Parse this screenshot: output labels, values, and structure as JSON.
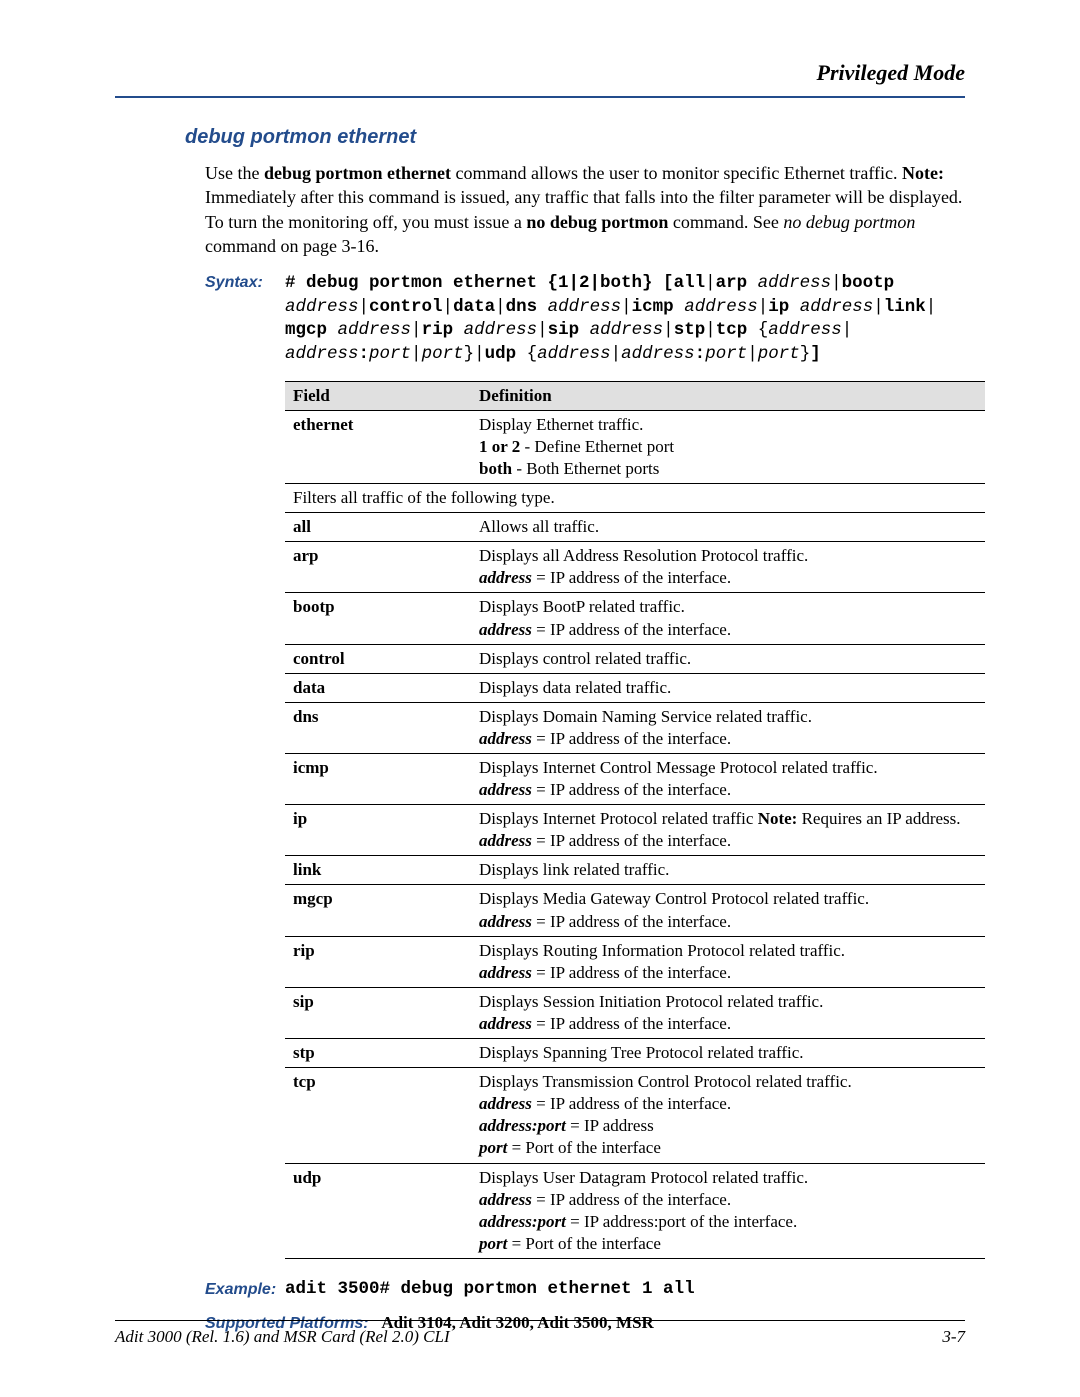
{
  "header": {
    "title": "Privileged Mode"
  },
  "section": {
    "title": "debug portmon ethernet"
  },
  "intro": {
    "html": "Use the <b>debug portmon ethernet</b> command allows the user to monitor specific Ethernet traffic. <b>Note:</b> Immediately after this command is issued, any traffic that falls into the filter parameter will be displayed. To turn the monitoring off, you must issue a <b>no debug portmon</b> command. See <i>no debug portmon</i> command on page 3-16."
  },
  "syntax": {
    "label": "Syntax:",
    "code": "<b># debug portmon ethernet {1|2|both} [all</b>|<b>arp</b> <i>address</i>|<b>bootp</b> <i>address</i>|<b>control</b>|<b>data</b>|<b>dns</b> <i>address</i>|<b>icmp</b> <i>address</i>|<b>ip</b> <i>address</i>|<b>link</b>| <b>mgcp</b> <i>address</i>|<b>rip</b> <i>address</i>|<b>sip</b> <i>address</i>|<b>stp</b>|<b>tcp</b> {<i>address</i>| <i>address</i><b>:</b><i>port</i>|<i>port</i>}|<b>udp</b> {<i>address</i>|<i>address</i><b>:</b><i>port</i>|<i>port</i>}<b>]</b>"
  },
  "table": {
    "headers": {
      "field": "Field",
      "definition": "Definition"
    },
    "rows": [
      {
        "field": "ethernet",
        "def": "Display Ethernet traffic.<br><b>1 or 2</b> - Define Ethernet port<br><b>both</b> - Both Ethernet ports"
      },
      {
        "merged": true,
        "def": "Filters all traffic of the following type."
      },
      {
        "field": "all",
        "def": "Allows all traffic."
      },
      {
        "field": "arp",
        "def": "Displays all Address Resolution Protocol traffic.<br><i>address</i> = IP address of the interface."
      },
      {
        "field": "bootp",
        "def": "Displays BootP related traffic.<br><i>address</i> = IP address of the interface."
      },
      {
        "field": "control",
        "def": "Displays control related traffic."
      },
      {
        "field": "data",
        "def": "Displays data related traffic."
      },
      {
        "field": "dns",
        "def": "Displays Domain Naming Service related traffic.<br><i>address</i> = IP address of the interface."
      },
      {
        "field": "icmp",
        "def": "Displays Internet Control Message Protocol related traffic.<br><i>address</i> = IP address of the interface."
      },
      {
        "field": "ip",
        "def": "Displays Internet Protocol related traffic <b class=\"note-bold\">Note:</b> Requires an IP address.<br><i>address</i> = IP address of the interface."
      },
      {
        "field": "link",
        "def": "Displays link related traffic."
      },
      {
        "field": "mgcp",
        "def": "Displays Media Gateway Control Protocol related traffic.<br><i>address</i> = IP address of the interface."
      },
      {
        "field": "rip",
        "def": "Displays Routing Information Protocol related traffic.<br><i>address</i> = IP address of the interface."
      },
      {
        "field": "sip",
        "def": "Displays Session Initiation Protocol related traffic.<br><i>address</i> = IP address of the interface."
      },
      {
        "field": "stp",
        "def": "Displays Spanning Tree Protocol related traffic."
      },
      {
        "field": "tcp",
        "def": "Displays Transmission Control Protocol related traffic.<br><i>address</i> = IP address of the interface.<br><i>address:port</i> = IP address<br><i>port</i> = Port of the interface"
      },
      {
        "field": "udp",
        "def": "Displays User Datagram Protocol related traffic.<br><i>address</i> = IP address of the interface.<br><i>address:port</i> = IP address:port of the interface.<br><i>port</i> = Port of the interface"
      }
    ]
  },
  "example": {
    "label": "Example:",
    "code": "adit 3500# debug portmon ethernet 1 all"
  },
  "supported": {
    "label": "Supported Platforms:",
    "value": "Adit 3104, Adit 3200, Adit 3500, MSR"
  },
  "footer": {
    "left": "Adit 3000 (Rel. 1.6) and MSR Card (Rel 2.0) CLI",
    "right": "3-7"
  }
}
